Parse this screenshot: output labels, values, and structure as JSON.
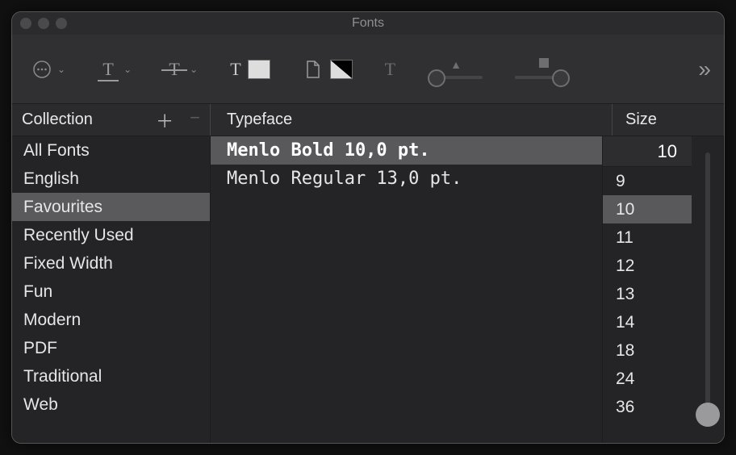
{
  "window": {
    "title": "Fonts"
  },
  "headers": {
    "collection": "Collection",
    "typeface": "Typeface",
    "size": "Size"
  },
  "collections": {
    "selectedIndex": 2,
    "items": [
      {
        "label": "All Fonts"
      },
      {
        "label": "English"
      },
      {
        "label": "Favourites"
      },
      {
        "label": "Recently Used"
      },
      {
        "label": "Fixed Width"
      },
      {
        "label": "Fun"
      },
      {
        "label": "Modern"
      },
      {
        "label": "PDF"
      },
      {
        "label": "Traditional"
      },
      {
        "label": "Web"
      }
    ]
  },
  "typefaces": {
    "selectedIndex": 0,
    "items": [
      {
        "label": "Menlo Bold 10,0 pt."
      },
      {
        "label": "Menlo Regular 13,0 pt."
      }
    ]
  },
  "size": {
    "current": "10",
    "selectedIndex": 1,
    "options": [
      "9",
      "10",
      "11",
      "12",
      "13",
      "14",
      "18",
      "24",
      "36"
    ]
  },
  "toolbar": {
    "icons": {
      "actions": "actions-menu",
      "underline": "underline-menu",
      "strike": "strikethrough-menu",
      "textcolor": "text-color",
      "pagecolor": "document-color",
      "shadow": "text-shadow",
      "more": "more"
    }
  },
  "colors": {
    "panel": "#303032",
    "text": "#e6e6e8"
  }
}
